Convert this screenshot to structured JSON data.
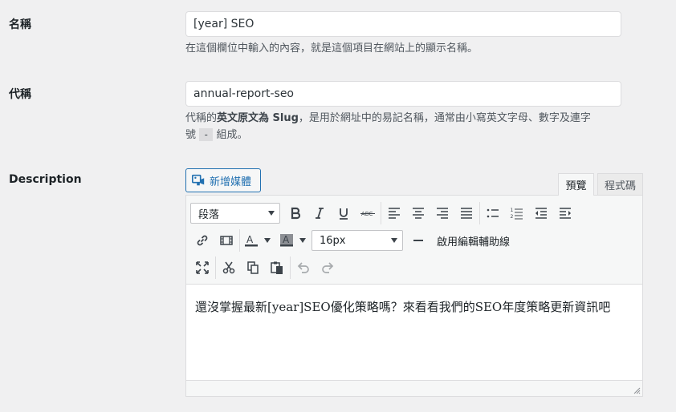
{
  "fields": {
    "name": {
      "label": "名稱",
      "value": "[year] SEO",
      "description": "在這個欄位中輸入的內容，就是這個項目在網站上的顯示名稱。"
    },
    "slug": {
      "label": "代稱",
      "value": "annual-report-seo",
      "description_prefix": "代稱的",
      "description_bold": "英文原文為 Slug",
      "description_middle": "，是用於網址中的易記名稱，通常由小寫英文字母、數字及連字",
      "description_line2_start": "號",
      "description_code": "-",
      "description_line2_end": "組成。"
    },
    "description": {
      "label": "Description"
    }
  },
  "editor": {
    "add_media_label": "新增媒體",
    "tabs": {
      "visual": "預覽",
      "text": "程式碼"
    },
    "format_select": "段落",
    "font_size_select": "16px",
    "editing_aid_label": "啟用編輯輔助線",
    "content": "還沒掌握最新[year]SEO優化策略嗎？來看看我們的SEO年度策略更新資訊吧"
  },
  "colors": {
    "background": "#f0f0f1",
    "accent": "#2271b1",
    "border": "#dcdcde",
    "toolbar_bg": "#f6f7f7"
  }
}
